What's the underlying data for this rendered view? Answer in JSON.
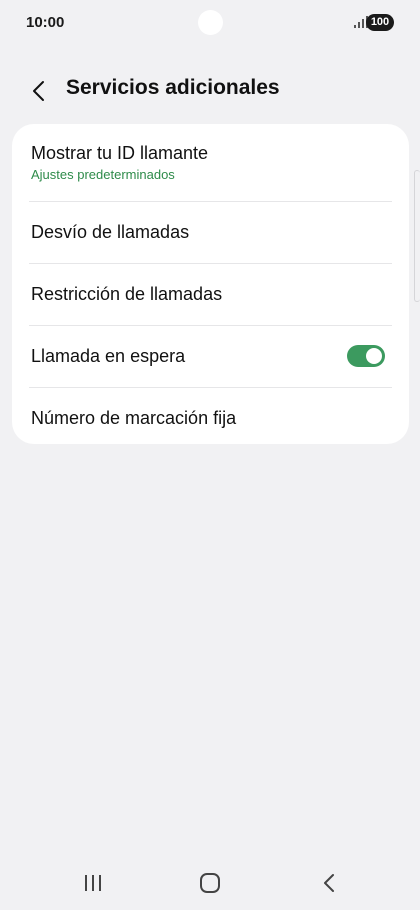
{
  "status_bar": {
    "time": "10:00",
    "battery": "100"
  },
  "header": {
    "title": "Servicios adicionales"
  },
  "settings": {
    "items": [
      {
        "label": "Mostrar tu ID llamante",
        "sub": "Ajustes predeterminados"
      },
      {
        "label": "Desvío de llamadas"
      },
      {
        "label": "Restricción de llamadas"
      },
      {
        "label": "Llamada en espera",
        "toggle_on": true
      },
      {
        "label": "Número de marcación fija"
      }
    ]
  },
  "colors": {
    "accent": "#3c9a5f",
    "subtitle": "#2e8b4a",
    "background": "#f1f1f3"
  }
}
